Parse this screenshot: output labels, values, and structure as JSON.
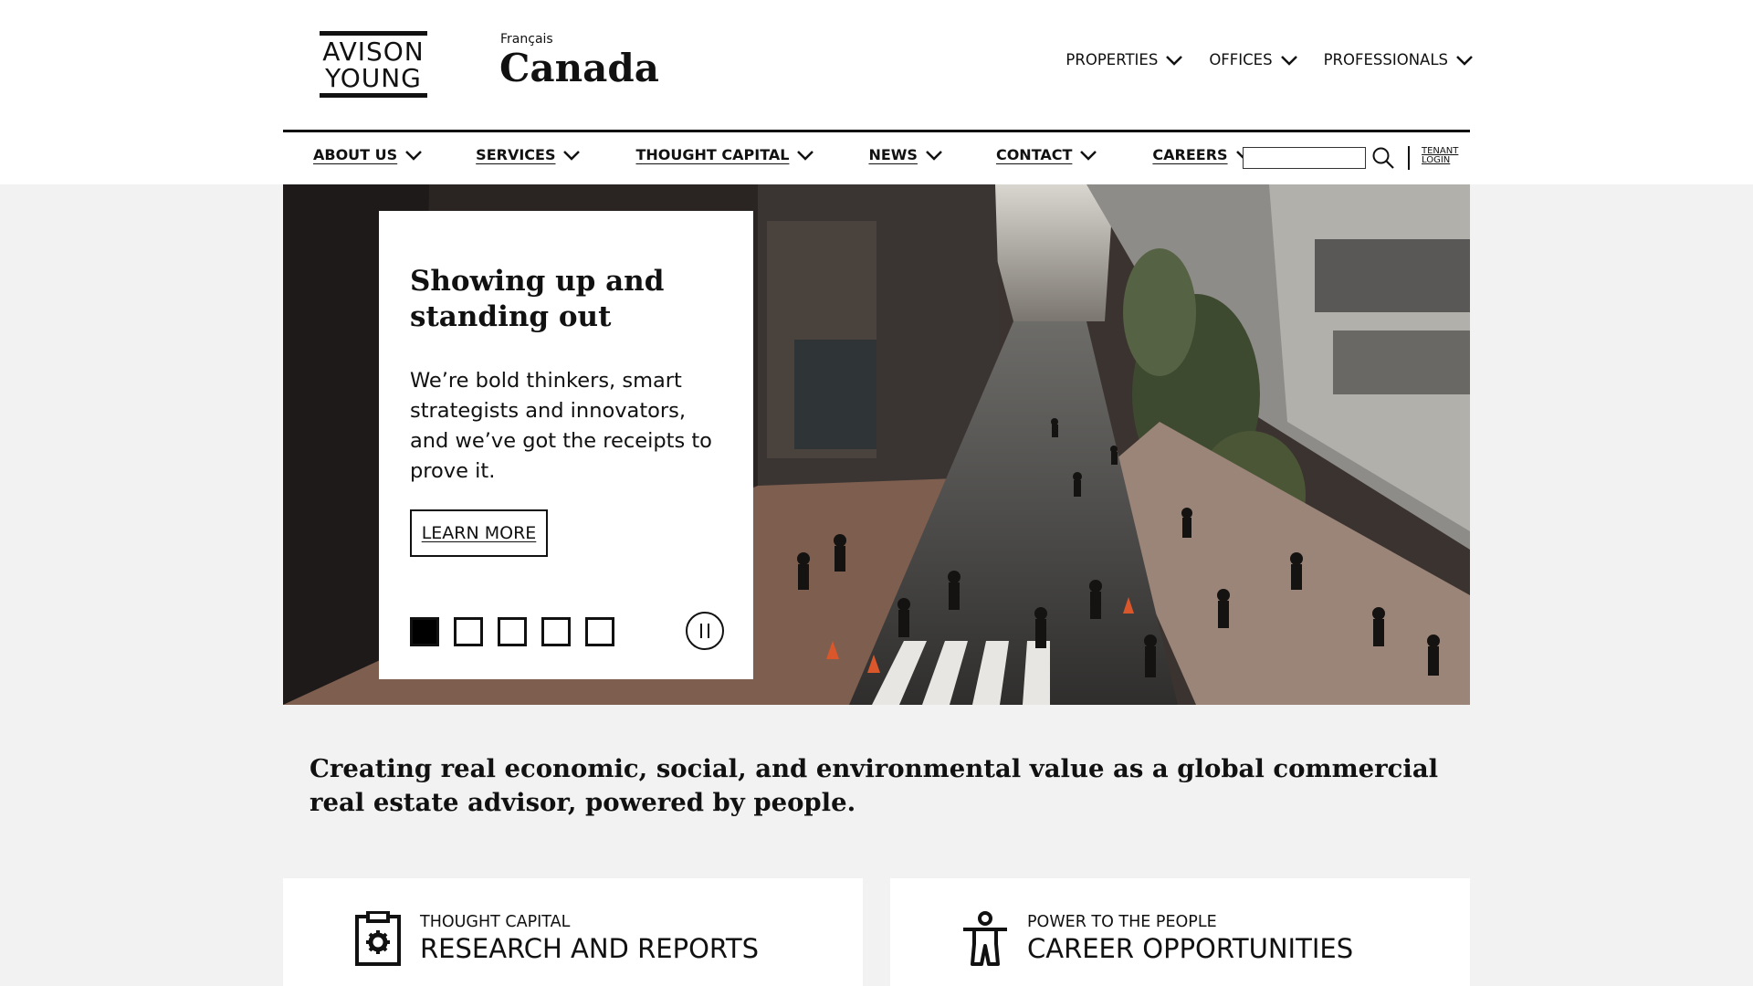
{
  "header": {
    "logo_line1": "AVISON",
    "logo_line2": "YOUNG",
    "language_link": "Français",
    "country": "Canada"
  },
  "top_nav": [
    {
      "label": "PROPERTIES"
    },
    {
      "label": "OFFICES"
    },
    {
      "label": "PROFESSIONALS"
    }
  ],
  "main_nav": [
    {
      "label": "ABOUT US"
    },
    {
      "label": "SERVICES"
    },
    {
      "label": "THOUGHT CAPITAL"
    },
    {
      "label": "NEWS"
    },
    {
      "label": "CONTACT"
    },
    {
      "label": "CAREERS"
    }
  ],
  "search": {
    "placeholder": "",
    "value": ""
  },
  "tenant_login": {
    "line1": "TENANT",
    "line2": "LOGIN"
  },
  "hero": {
    "heading": "Showing up and standing out",
    "body": "We’re bold thinkers, smart strategists and innovators, and we’ve got the receipts to prove it.",
    "cta": "LEARN MORE",
    "slide_count": 5,
    "active_slide": 1
  },
  "tagline": "Creating real economic, social, and environmental value as a global commercial real estate advisor, powered by people.",
  "tiles": [
    {
      "kicker": "THOUGHT CAPITAL",
      "title": "RESEARCH AND REPORTS",
      "icon": "clipboard-gear-icon"
    },
    {
      "kicker": "POWER TO THE PEOPLE",
      "title": "CAREER OPPORTUNITIES",
      "icon": "person-icon"
    }
  ],
  "colors": {
    "accent": "#111111",
    "page_bg": "#f2f2f2",
    "header_bg": "#ffffff"
  }
}
